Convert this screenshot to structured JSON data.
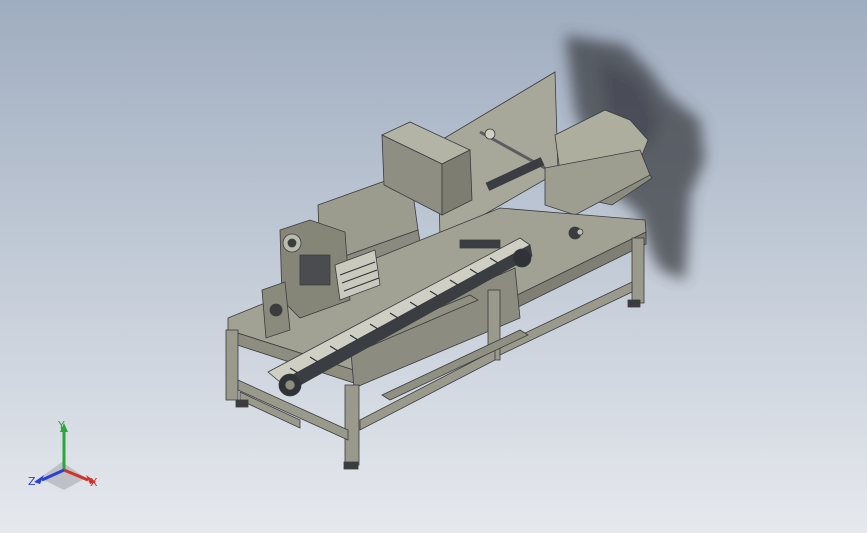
{
  "viewport": {
    "background_top": "#9fadc0",
    "background_bottom": "#e6e9ee"
  },
  "model": {
    "frame_color": "#9a9a8c",
    "panel_color": "#8d8d80",
    "dark_color": "#2f3236",
    "edge_color": "#3a3c3e"
  },
  "triad": {
    "x_label": "X",
    "y_label": "Y",
    "z_label": "Z",
    "x_color": "#d0322c",
    "y_color": "#2aa63a",
    "z_color": "#2b3fd6"
  }
}
